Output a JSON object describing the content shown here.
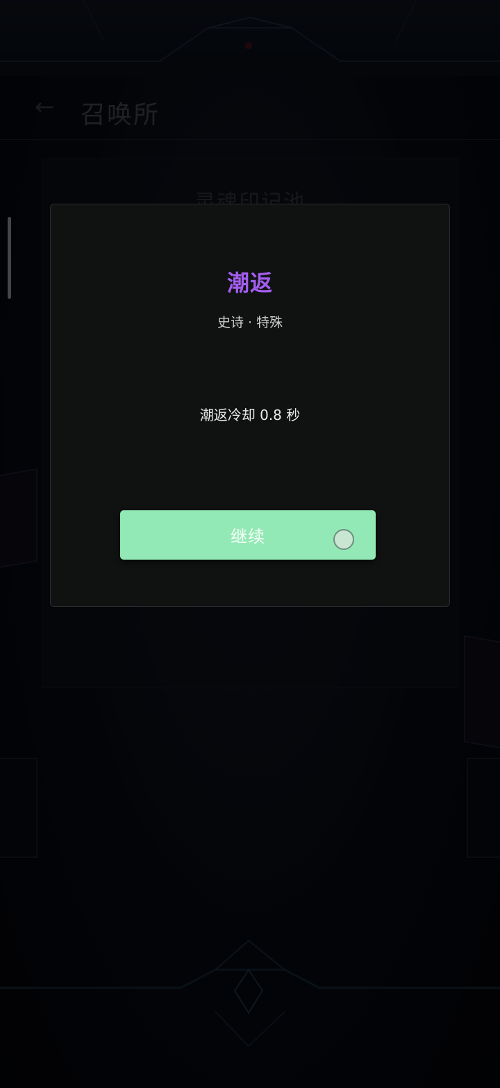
{
  "header": {
    "back_icon": "arrow-left-icon",
    "title": "召唤所"
  },
  "background": {
    "pool_title": "灵魂印记池"
  },
  "dialog": {
    "title": "潮返",
    "subtitle": "史诗 · 特殊",
    "description": "潮返冷却 0.8 秒",
    "continue_label": "继续"
  },
  "colors": {
    "title_accent": "#a35ef0",
    "button_bg": "#93e9b5",
    "dialog_bg": "#0f1211"
  }
}
